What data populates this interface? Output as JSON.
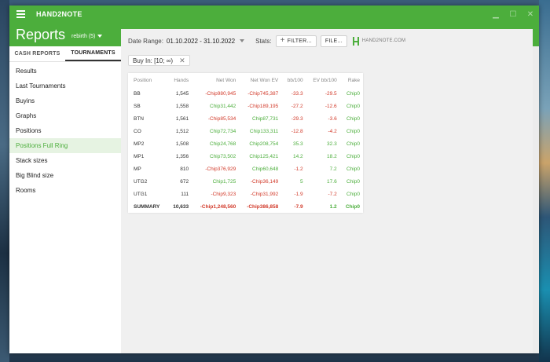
{
  "app": {
    "title": "HAND2NOTE",
    "minimize_glyph": "▁",
    "maximize_glyph": "☐",
    "close_glyph": "✕"
  },
  "header": {
    "title": "Reports",
    "profile": "rebirth (5)"
  },
  "sidebar": {
    "tabs": [
      {
        "label": "CASH REPORTS",
        "active": false
      },
      {
        "label": "TOURNAMENTS",
        "active": true
      }
    ],
    "items": [
      {
        "label": "Results",
        "active": false
      },
      {
        "label": "Last Tournaments",
        "active": false
      },
      {
        "label": "Buyins",
        "active": false
      },
      {
        "label": "Graphs",
        "active": false
      },
      {
        "label": "Positions",
        "active": false
      },
      {
        "label": "Positions Full Ring",
        "active": true
      },
      {
        "label": "Stack sizes",
        "active": false
      },
      {
        "label": "Big Blind size",
        "active": false
      },
      {
        "label": "Rooms",
        "active": false
      }
    ]
  },
  "toolbar": {
    "date_range_label": "Date Range:",
    "date_range_value": "01.10.2022 - 31.10.2022",
    "stats_label": "Stats:",
    "filter_label": "FILTER...",
    "file_label": "FILE...",
    "brand": "HAND2NOTE.COM"
  },
  "filter_chip": {
    "label": "Buy In: [10; ∞)",
    "close_glyph": "✕"
  },
  "colors": {
    "accent_green": "#4cae3c",
    "negative_red": "#d23a2a"
  },
  "table": {
    "columns": [
      "Position",
      "Hands",
      "Net Won",
      "Net Won  EV",
      "bb/100",
      "EV bb/100",
      "Rake"
    ],
    "rows": [
      {
        "position": "BB",
        "hands": "1,545",
        "net_won": "-Chip980,945",
        "net_won_ev": "-Chip745,387",
        "bb100": "-33.3",
        "ev_bb100": "-29.5",
        "rake": "Chip0"
      },
      {
        "position": "SB",
        "hands": "1,558",
        "net_won": "Chip31,442",
        "net_won_ev": "-Chip189,195",
        "bb100": "-27.2",
        "ev_bb100": "-12.6",
        "rake": "Chip0"
      },
      {
        "position": "BTN",
        "hands": "1,561",
        "net_won": "-Chip85,534",
        "net_won_ev": "Chip87,731",
        "bb100": "-29.3",
        "ev_bb100": "-3.6",
        "rake": "Chip0"
      },
      {
        "position": "CO",
        "hands": "1,512",
        "net_won": "Chip72,734",
        "net_won_ev": "Chip133,311",
        "bb100": "-12.8",
        "ev_bb100": "-4.2",
        "rake": "Chip0"
      },
      {
        "position": "MP2",
        "hands": "1,508",
        "net_won": "Chip24,768",
        "net_won_ev": "Chip208,754",
        "bb100": "35.3",
        "ev_bb100": "32.3",
        "rake": "Chip0"
      },
      {
        "position": "MP1",
        "hands": "1,356",
        "net_won": "Chip73,502",
        "net_won_ev": "Chip125,421",
        "bb100": "14.2",
        "ev_bb100": "18.2",
        "rake": "Chip0"
      },
      {
        "position": "MP",
        "hands": "810",
        "net_won": "-Chip376,929",
        "net_won_ev": "Chip60,648",
        "bb100": "-1.2",
        "ev_bb100": "7.2",
        "rake": "Chip0"
      },
      {
        "position": "UTG2",
        "hands": "672",
        "net_won": "Chip1,725",
        "net_won_ev": "-Chip36,149",
        "bb100": "5",
        "ev_bb100": "17.6",
        "rake": "Chip0"
      },
      {
        "position": "UTG1",
        "hands": "111",
        "net_won": "-Chip9,323",
        "net_won_ev": "-Chip31,992",
        "bb100": "-1.9",
        "ev_bb100": "-7.2",
        "rake": "Chip0"
      }
    ],
    "summary": {
      "position": "SUMMARY",
      "hands": "10,633",
      "net_won": "-Chip1,248,560",
      "net_won_ev": "-Chip386,858",
      "bb100": "-7.9",
      "ev_bb100": "1.2",
      "rake": "Chip0"
    }
  }
}
